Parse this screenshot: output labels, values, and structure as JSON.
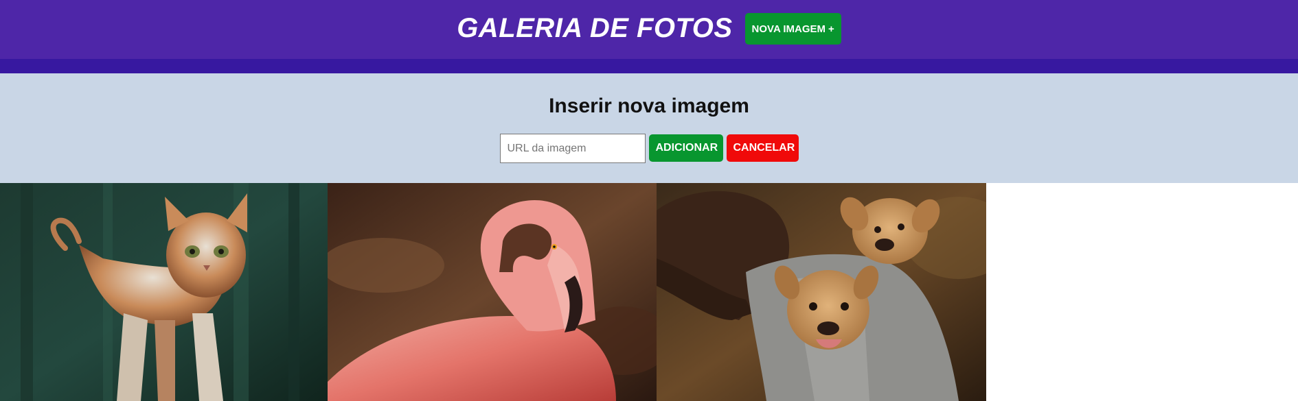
{
  "header": {
    "title": "GALERIA DE FOTOS",
    "new_image_label": "NOVA IMAGEM",
    "new_image_icon": "+"
  },
  "form": {
    "title": "Inserir nova imagem",
    "url_placeholder": "URL da imagem",
    "url_value": "",
    "add_label": "ADICIONAR",
    "cancel_label": "CANCELAR"
  },
  "gallery": {
    "photos": [
      {
        "subject": "cat"
      },
      {
        "subject": "flamingo"
      },
      {
        "subject": "puppies"
      }
    ]
  },
  "colors": {
    "header_bg": "#4e26a8",
    "header_stripe": "#3718a0",
    "form_bg": "#c9d6e6",
    "add_button": "#08962f",
    "cancel_button": "#f00a0a"
  }
}
